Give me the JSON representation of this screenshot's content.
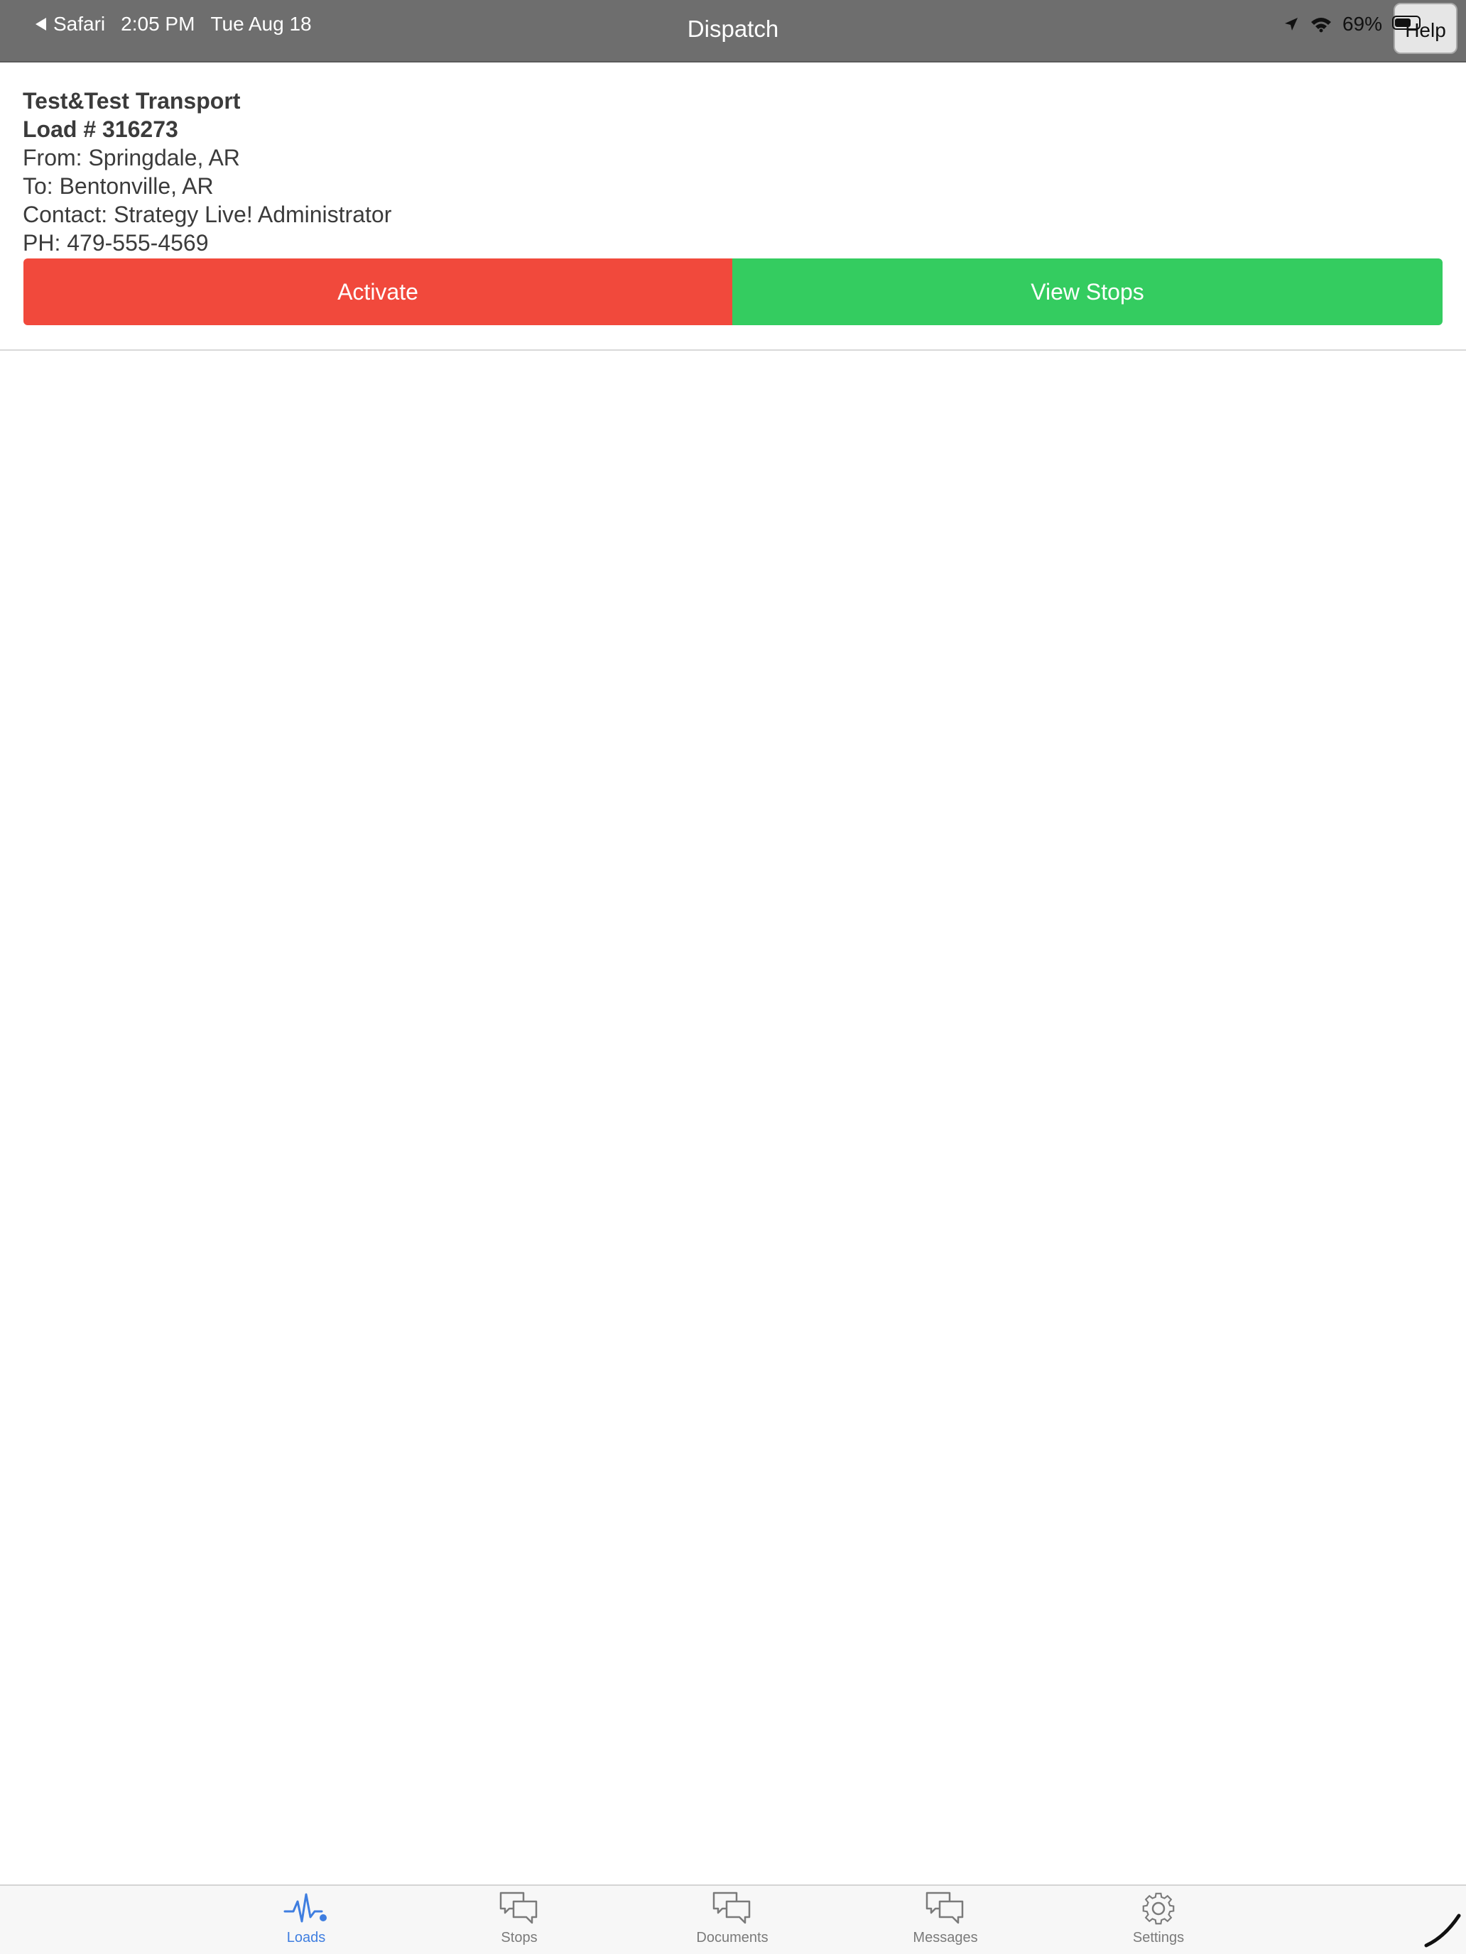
{
  "status_bar": {
    "back_app": "Safari",
    "time": "2:05 PM",
    "date": "Tue Aug 18",
    "battery": "69%"
  },
  "nav": {
    "title": "Dispatch",
    "help_label": "Help"
  },
  "load": {
    "company": "Test&Test Transport",
    "load_number": "Load # 316273",
    "from": "From: Springdale, AR",
    "to": "To: Bentonville, AR",
    "contact": "Contact: Strategy Live! Administrator",
    "phone": "PH: 479-555-4569"
  },
  "actions": {
    "activate_label": "Activate",
    "view_stops_label": "View Stops"
  },
  "tabs": [
    {
      "label": "Loads",
      "icon": "pulse-icon",
      "active": true
    },
    {
      "label": "Stops",
      "icon": "chat-bubbles-icon",
      "active": false
    },
    {
      "label": "Documents",
      "icon": "chat-bubbles-icon",
      "active": false
    },
    {
      "label": "Messages",
      "icon": "chat-bubbles-icon",
      "active": false
    },
    {
      "label": "Settings",
      "icon": "gear-icon",
      "active": false
    }
  ],
  "colors": {
    "header": "#6e6e6e",
    "activate": "#f1493c",
    "view_stops": "#34cc60",
    "tab_active": "#3f7ee0",
    "tab_inactive": "#7a7a7a"
  }
}
